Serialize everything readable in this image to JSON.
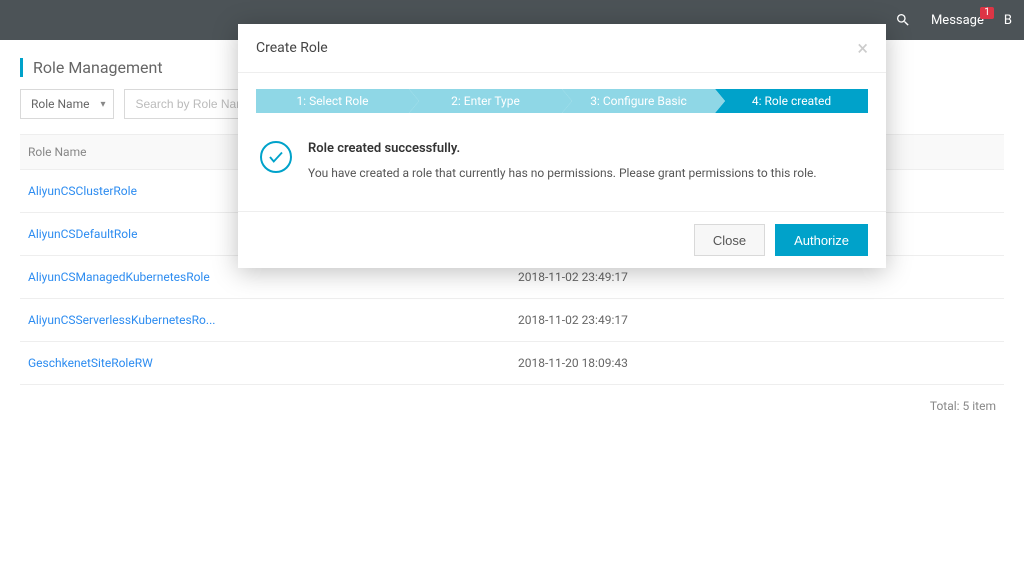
{
  "topbar": {
    "message_label": "Message",
    "message_badge": "1",
    "extra": "B"
  },
  "page": {
    "title": "Role Management"
  },
  "filter": {
    "select_label": "Role Name",
    "search_placeholder": "Search by Role Name"
  },
  "table": {
    "header_name": "Role Name",
    "rows": [
      {
        "name": "AliyunCSClusterRole",
        "date": ""
      },
      {
        "name": "AliyunCSDefaultRole",
        "date": ""
      },
      {
        "name": "AliyunCSManagedKubernetesRole",
        "date": "2018-11-02 23:49:17"
      },
      {
        "name": "AliyunCSServerlessKubernetesRo...",
        "date": "2018-11-02 23:49:17"
      },
      {
        "name": "GeschkenetSiteRoleRW",
        "date": "2018-11-20 18:09:43"
      }
    ],
    "footer": "Total: 5 item"
  },
  "modal": {
    "title": "Create Role",
    "steps": [
      "1:  Select Role",
      "2:  Enter Type",
      "3:  Configure Basic",
      "4:  Role created"
    ],
    "success_title": "Role created successfully.",
    "success_body": "You have created a role that currently has no permissions. Please grant permissions to this role.",
    "close_label": "Close",
    "authorize_label": "Authorize"
  }
}
